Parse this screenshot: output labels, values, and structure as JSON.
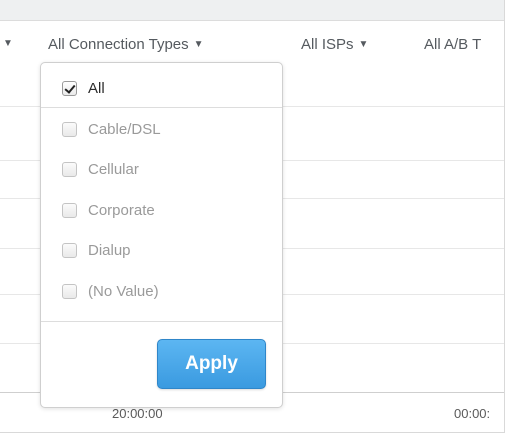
{
  "filter_bar": {
    "leading_caret": "▼",
    "connection_types_label": "All Connection Types",
    "isps_label": "All ISPs",
    "ab_label": "All A/B T",
    "caret": "▼"
  },
  "chart": {
    "x_ticks": [
      "20:00:00",
      "00:00:"
    ]
  },
  "dropdown": {
    "options": [
      {
        "label": "All",
        "checked": true
      },
      {
        "label": "Cable/DSL",
        "checked": false
      },
      {
        "label": "Cellular",
        "checked": false
      },
      {
        "label": "Corporate",
        "checked": false
      },
      {
        "label": "Dialup",
        "checked": false
      },
      {
        "label": "(No Value)",
        "checked": false
      }
    ],
    "apply_label": "Apply"
  },
  "colors": {
    "apply_button": "#3a9ae0",
    "muted_text": "#9a9a9a"
  }
}
